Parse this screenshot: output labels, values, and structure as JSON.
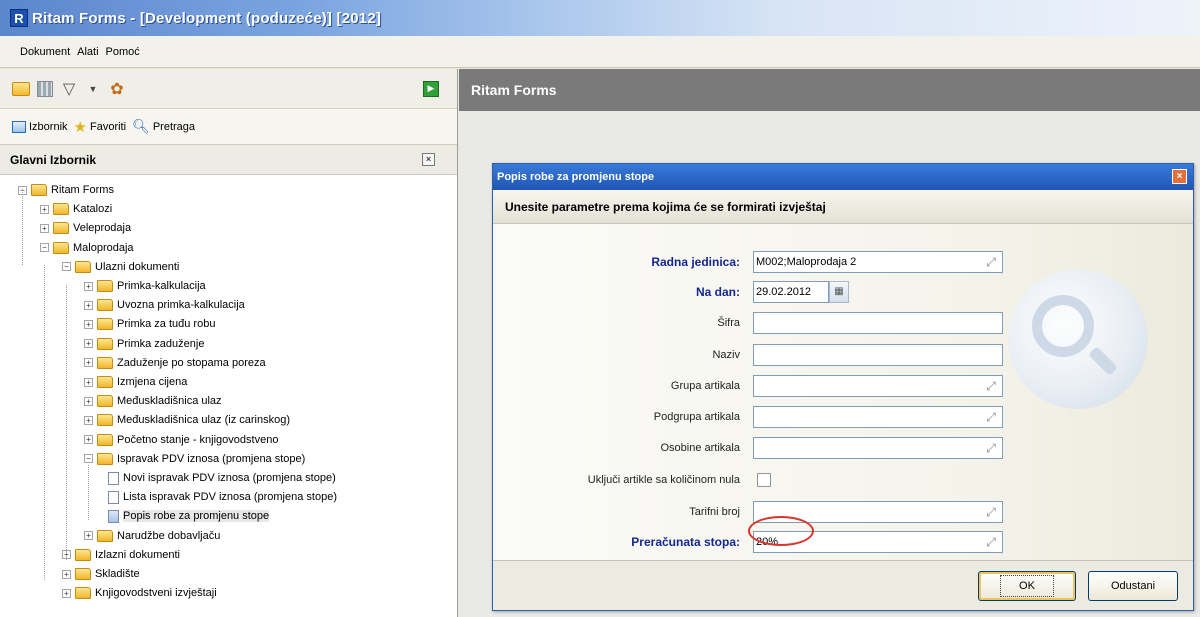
{
  "window": {
    "logo_letter": "R",
    "title": "Ritam Forms - [Development (poduzeće)] [2012]"
  },
  "menu": [
    "Dokument",
    "Alati",
    "Pomoć"
  ],
  "left_tabs": [
    "Izbornik",
    "Favoriti",
    "Pretraga"
  ],
  "panel": {
    "title": "Glavni Izbornik"
  },
  "tree": [
    {
      "label": "Ritam Forms",
      "level": 0,
      "type": "folder",
      "exp": "−"
    },
    {
      "label": "Katalozi",
      "level": 1,
      "type": "folder",
      "exp": "+"
    },
    {
      "label": "Veleprodaja",
      "level": 1,
      "type": "folder",
      "exp": "+"
    },
    {
      "label": "Maloprodaja",
      "level": 1,
      "type": "folder",
      "exp": "−"
    },
    {
      "label": "Ulazni dokumenti",
      "level": 2,
      "type": "folder",
      "exp": "−"
    },
    {
      "label": "Primka-kalkulacija",
      "level": 3,
      "type": "folder",
      "exp": "+"
    },
    {
      "label": "Uvozna primka-kalkulacija",
      "level": 3,
      "type": "folder",
      "exp": "+"
    },
    {
      "label": "Primka za tuđu robu",
      "level": 3,
      "type": "folder",
      "exp": "+"
    },
    {
      "label": "Primka zaduženje",
      "level": 3,
      "type": "folder",
      "exp": "+"
    },
    {
      "label": "Zaduženje po stopama poreza",
      "level": 3,
      "type": "folder",
      "exp": "+"
    },
    {
      "label": "Izmjena cijena",
      "level": 3,
      "type": "folder",
      "exp": "+"
    },
    {
      "label": "Međuskladišnica ulaz",
      "level": 3,
      "type": "folder",
      "exp": "+"
    },
    {
      "label": "Međuskladišnica ulaz (iz carinskog)",
      "level": 3,
      "type": "folder",
      "exp": "+"
    },
    {
      "label": "Početno stanje - knjigovodstveno",
      "level": 3,
      "type": "folder",
      "exp": "+"
    },
    {
      "label": "Ispravak PDV iznosa (promjena stope)",
      "level": 3,
      "type": "folder",
      "exp": "−"
    },
    {
      "label": "Novi ispravak PDV iznosa (promjena stope)",
      "level": 4,
      "type": "doc"
    },
    {
      "label": "Lista ispravak PDV iznosa (promjena stope)",
      "level": 4,
      "type": "doc"
    },
    {
      "label": "Popis robe za promjenu stope",
      "level": 4,
      "type": "doc-blue"
    },
    {
      "label": "Narudžbe dobavljaču",
      "level": 3,
      "type": "folder",
      "exp": "+"
    },
    {
      "label": "Izlazni dokumenti",
      "level": 2,
      "type": "folder",
      "exp": "+"
    },
    {
      "label": "Skladište",
      "level": 2,
      "type": "folder",
      "exp": "+"
    },
    {
      "label": "Knjigovodstveni izvještaji",
      "level": 2,
      "type": "folder",
      "exp": "+"
    }
  ],
  "right": {
    "header": "Ritam Forms"
  },
  "dialog": {
    "title": "Popis robe za promjenu stope",
    "instruction": "Unesite parametre prema kojima će se formirati izvještaj",
    "fields": {
      "radna_jedinica": {
        "label": "Radna jedinica:",
        "value": "M002;Maloprodaja 2"
      },
      "na_dan": {
        "label": "Na dan:",
        "value": "29.02.2012"
      },
      "sifra": {
        "label": "Šifra",
        "value": ""
      },
      "naziv": {
        "label": "Naziv",
        "value": ""
      },
      "grupa": {
        "label": "Grupa artikala",
        "value": ""
      },
      "podgrupa": {
        "label": "Podgrupa artikala",
        "value": ""
      },
      "osobine": {
        "label": "Osobine artikala",
        "value": ""
      },
      "ukljuci": {
        "label": "Uključi artikle sa količinom nula"
      },
      "tarifni": {
        "label": "Tarifni broj",
        "value": ""
      },
      "stopa": {
        "label": "Preračunata stopa:",
        "value": "20%"
      }
    },
    "ok": "OK",
    "cancel": "Odustani"
  },
  "colors": {
    "title_bar": "#5c86cc",
    "dialog_title": "#1f56b6",
    "label_bold": "#14268f",
    "highlight_circle": "#d9342b",
    "right_header": "#7a7a7a"
  }
}
